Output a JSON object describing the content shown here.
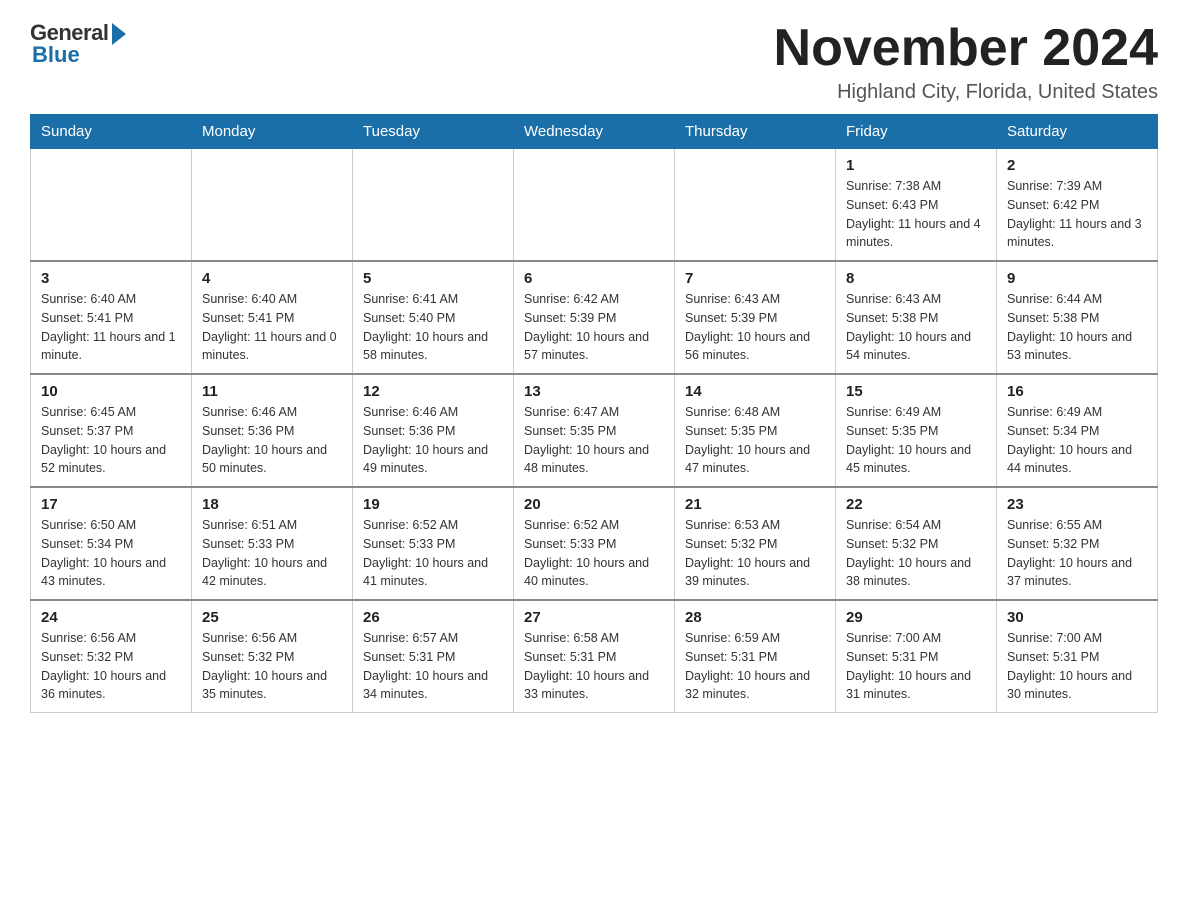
{
  "logo": {
    "general": "General",
    "blue": "Blue"
  },
  "title": {
    "month": "November 2024",
    "location": "Highland City, Florida, United States"
  },
  "days_of_week": [
    "Sunday",
    "Monday",
    "Tuesday",
    "Wednesday",
    "Thursday",
    "Friday",
    "Saturday"
  ],
  "weeks": [
    [
      {
        "day": "",
        "info": ""
      },
      {
        "day": "",
        "info": ""
      },
      {
        "day": "",
        "info": ""
      },
      {
        "day": "",
        "info": ""
      },
      {
        "day": "",
        "info": ""
      },
      {
        "day": "1",
        "info": "Sunrise: 7:38 AM\nSunset: 6:43 PM\nDaylight: 11 hours and 4 minutes."
      },
      {
        "day": "2",
        "info": "Sunrise: 7:39 AM\nSunset: 6:42 PM\nDaylight: 11 hours and 3 minutes."
      }
    ],
    [
      {
        "day": "3",
        "info": "Sunrise: 6:40 AM\nSunset: 5:41 PM\nDaylight: 11 hours and 1 minute."
      },
      {
        "day": "4",
        "info": "Sunrise: 6:40 AM\nSunset: 5:41 PM\nDaylight: 11 hours and 0 minutes."
      },
      {
        "day": "5",
        "info": "Sunrise: 6:41 AM\nSunset: 5:40 PM\nDaylight: 10 hours and 58 minutes."
      },
      {
        "day": "6",
        "info": "Sunrise: 6:42 AM\nSunset: 5:39 PM\nDaylight: 10 hours and 57 minutes."
      },
      {
        "day": "7",
        "info": "Sunrise: 6:43 AM\nSunset: 5:39 PM\nDaylight: 10 hours and 56 minutes."
      },
      {
        "day": "8",
        "info": "Sunrise: 6:43 AM\nSunset: 5:38 PM\nDaylight: 10 hours and 54 minutes."
      },
      {
        "day": "9",
        "info": "Sunrise: 6:44 AM\nSunset: 5:38 PM\nDaylight: 10 hours and 53 minutes."
      }
    ],
    [
      {
        "day": "10",
        "info": "Sunrise: 6:45 AM\nSunset: 5:37 PM\nDaylight: 10 hours and 52 minutes."
      },
      {
        "day": "11",
        "info": "Sunrise: 6:46 AM\nSunset: 5:36 PM\nDaylight: 10 hours and 50 minutes."
      },
      {
        "day": "12",
        "info": "Sunrise: 6:46 AM\nSunset: 5:36 PM\nDaylight: 10 hours and 49 minutes."
      },
      {
        "day": "13",
        "info": "Sunrise: 6:47 AM\nSunset: 5:35 PM\nDaylight: 10 hours and 48 minutes."
      },
      {
        "day": "14",
        "info": "Sunrise: 6:48 AM\nSunset: 5:35 PM\nDaylight: 10 hours and 47 minutes."
      },
      {
        "day": "15",
        "info": "Sunrise: 6:49 AM\nSunset: 5:35 PM\nDaylight: 10 hours and 45 minutes."
      },
      {
        "day": "16",
        "info": "Sunrise: 6:49 AM\nSunset: 5:34 PM\nDaylight: 10 hours and 44 minutes."
      }
    ],
    [
      {
        "day": "17",
        "info": "Sunrise: 6:50 AM\nSunset: 5:34 PM\nDaylight: 10 hours and 43 minutes."
      },
      {
        "day": "18",
        "info": "Sunrise: 6:51 AM\nSunset: 5:33 PM\nDaylight: 10 hours and 42 minutes."
      },
      {
        "day": "19",
        "info": "Sunrise: 6:52 AM\nSunset: 5:33 PM\nDaylight: 10 hours and 41 minutes."
      },
      {
        "day": "20",
        "info": "Sunrise: 6:52 AM\nSunset: 5:33 PM\nDaylight: 10 hours and 40 minutes."
      },
      {
        "day": "21",
        "info": "Sunrise: 6:53 AM\nSunset: 5:32 PM\nDaylight: 10 hours and 39 minutes."
      },
      {
        "day": "22",
        "info": "Sunrise: 6:54 AM\nSunset: 5:32 PM\nDaylight: 10 hours and 38 minutes."
      },
      {
        "day": "23",
        "info": "Sunrise: 6:55 AM\nSunset: 5:32 PM\nDaylight: 10 hours and 37 minutes."
      }
    ],
    [
      {
        "day": "24",
        "info": "Sunrise: 6:56 AM\nSunset: 5:32 PM\nDaylight: 10 hours and 36 minutes."
      },
      {
        "day": "25",
        "info": "Sunrise: 6:56 AM\nSunset: 5:32 PM\nDaylight: 10 hours and 35 minutes."
      },
      {
        "day": "26",
        "info": "Sunrise: 6:57 AM\nSunset: 5:31 PM\nDaylight: 10 hours and 34 minutes."
      },
      {
        "day": "27",
        "info": "Sunrise: 6:58 AM\nSunset: 5:31 PM\nDaylight: 10 hours and 33 minutes."
      },
      {
        "day": "28",
        "info": "Sunrise: 6:59 AM\nSunset: 5:31 PM\nDaylight: 10 hours and 32 minutes."
      },
      {
        "day": "29",
        "info": "Sunrise: 7:00 AM\nSunset: 5:31 PM\nDaylight: 10 hours and 31 minutes."
      },
      {
        "day": "30",
        "info": "Sunrise: 7:00 AM\nSunset: 5:31 PM\nDaylight: 10 hours and 30 minutes."
      }
    ]
  ]
}
